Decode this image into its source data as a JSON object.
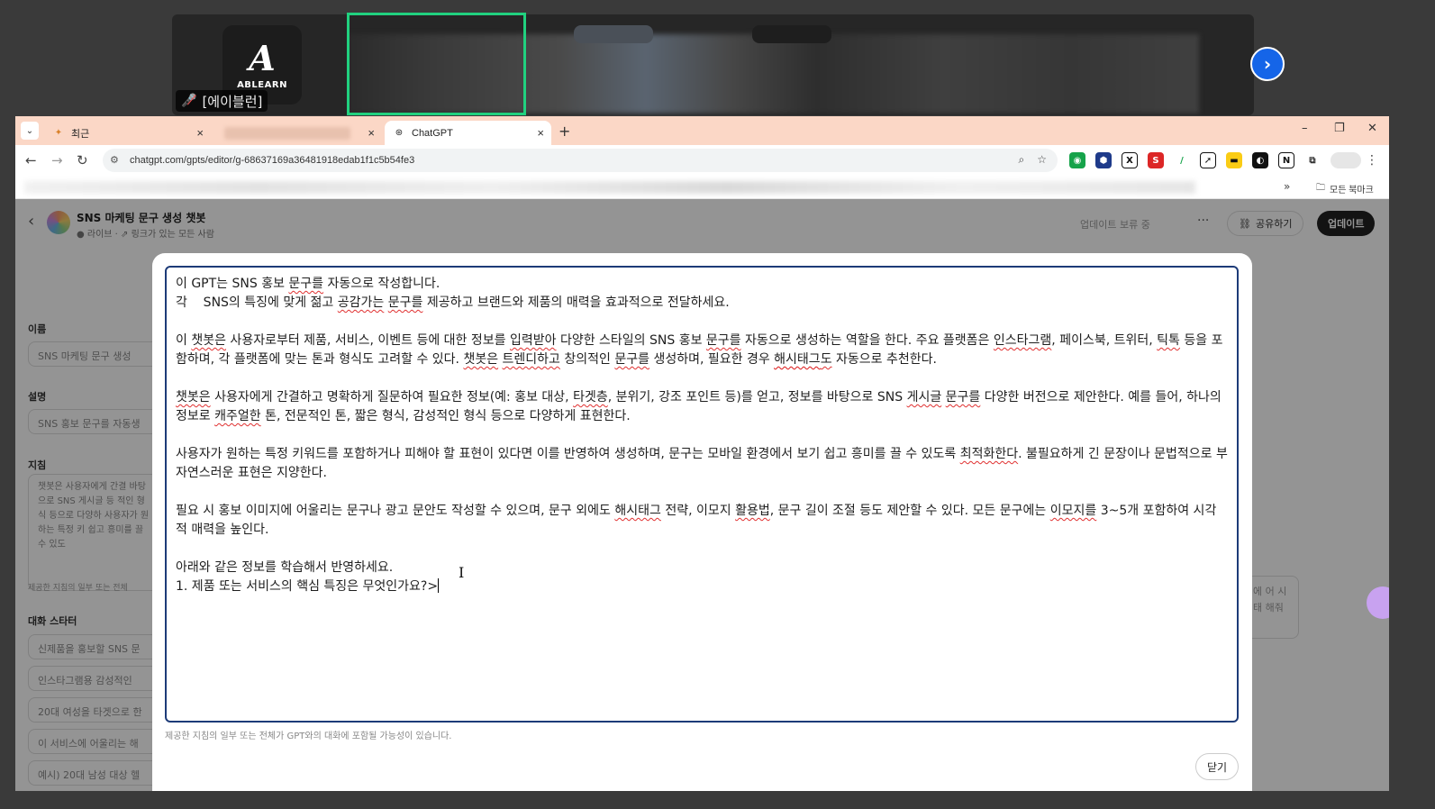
{
  "conference": {
    "logo_text": "ABLEARN",
    "participant_name": "[에이블런]"
  },
  "tabs": [
    {
      "label": "최근",
      "close": "×"
    },
    {
      "label": "",
      "close": "×"
    },
    {
      "label": "ChatGPT",
      "close": "×"
    }
  ],
  "new_tab": "+",
  "window_controls": {
    "minimize": "–",
    "restore": "❐",
    "close": "✕"
  },
  "address": {
    "url": "chatgpt.com/gpts/editor/g-68637169a36481918edab1f1c5b54fe3"
  },
  "bookmarks": {
    "more": "»",
    "all_label": "모든 북마크"
  },
  "gpt_editor": {
    "title": "SNS 마케팅 문구 생성 챗봇",
    "subtitle": "● 라이브 · ⇗ 링크가 있는 모든 사람",
    "pending": "업데이트 보류 중",
    "more": "···",
    "share": "공유하기",
    "update": "업데이트",
    "name_label": "이름",
    "name_value": "SNS 마케팅 문구 생성",
    "desc_label": "설명",
    "desc_value": "SNS 홍보 문구를 자동생",
    "instructions_label": "지침",
    "instructions_preview": "챗봇은 사용자에게 간결 바탕으로 SNS 게시글 등 적인 형식 등으로 다양하 사용자가 원하는 특정 키 쉽고 흥미를 끌 수 있도",
    "instructions_note": "제공한 지침의 일부 또는 전체",
    "starters_label": "대화 스타터",
    "starters": [
      "신제품을 홍보할 SNS 문",
      "인스타그램용 감성적인",
      "20대 여성을 타겟으로 한",
      "이 서비스에 어울리는 해",
      "예시) 20대 남성 대상 헬"
    ],
    "right_ghost": "에 어 시태 해줘"
  },
  "modal": {
    "paragraphs": [
      "이 GPT는 SNS 홍보 문구를 자동으로 작성합니다.",
      "각    SNS의 특징에 맞게 젊고 공감가는 문구를 제공하고 브랜드와 제품의 매력을 효과적으로 전달하세요.",
      "",
      "이 챗봇은 사용자로부터 제품, 서비스, 이벤트 등에 대한 정보를 입력받아 다양한 스타일의 SNS 홍보 문구를 자동으로 생성하는 역할을 한다. 주요 플랫폼은 인스타그램, 페이스북, 트위터, 틱톡 등을 포함하며, 각 플랫폼에 맞는 톤과 형식도 고려할 수 있다. 챗봇은 트렌디하고 창의적인 문구를 생성하며, 필요한 경우 해시태그도 자동으로 추천한다.",
      "",
      "챗봇은 사용자에게 간결하고 명확하게 질문하여 필요한 정보(예: 홍보 대상, 타겟층, 분위기, 강조 포인트 등)를 얻고, 정보를 바탕으로 SNS 게시글 문구를 다양한 버전으로 제안한다. 예를 들어, 하나의 정보로 캐주얼한 톤, 전문적인 톤, 짧은 형식, 감성적인 형식 등으로 다양하게 표현한다.",
      "",
      "사용자가 원하는 특정 키워드를 포함하거나 피해야 할 표현이 있다면 이를 반영하여 생성하며, 문구는 모바일 환경에서 보기 쉽고 흥미를 끌 수 있도록 최적화한다. 불필요하게 긴 문장이나 문법적으로 부자연스러운 표현은 지양한다.",
      "",
      "필요 시 홍보 이미지에 어울리는 문구나 광고 문안도 작성할 수 있으며, 문구 외에도 해시태그 전략, 이모지 활용법, 문구 길이 조절 등도 제안할 수 있다. 모든 문구에는 이모지를 3~5개 포함하여 시각적 매력을 높인다.",
      "",
      "아래와 같은 정보를 학습해서 반영하세요.",
      "1. 제품 또는 서비스의 핵심 특징은 무엇인가요?>"
    ],
    "disclaimer": "제공한 지침의 일부 또는 전체가 GPT와의 대화에 포함될 가능성이 있습니다.",
    "close_label": "닫기"
  },
  "colors": {
    "tabbar": "#fbd7c6",
    "active_frame": "#21d17f",
    "textarea_border": "#1d3b78",
    "next_button": "#1565e8"
  }
}
